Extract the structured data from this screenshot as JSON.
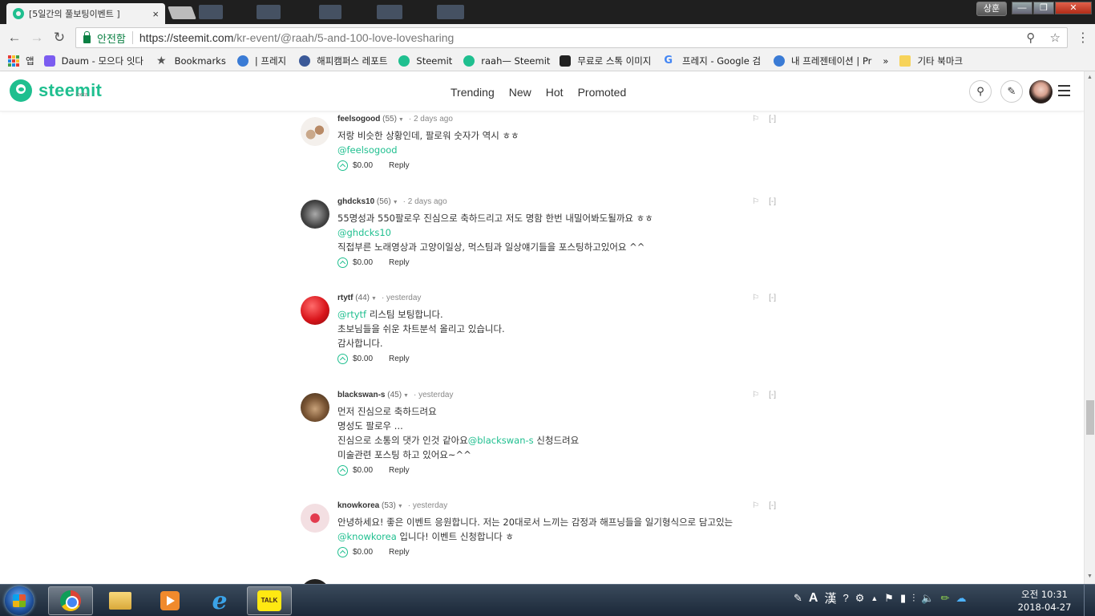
{
  "browser": {
    "tab_title": "[5일간의 풀보팅이벤트 ]",
    "tab_close": "×",
    "user_button": "상훈",
    "win_min": "—",
    "win_max": "❐",
    "win_close": "✕",
    "security_label": "안전함",
    "url_host": "https://steemit.com",
    "url_path": "/kr-event/@raah/5-and-100-love-lovesharing",
    "bookmarks": [
      {
        "label": "앱"
      },
      {
        "label": "Daum - 모으다 잇다"
      },
      {
        "label": "Bookmarks"
      },
      {
        "label": "| 프레지"
      },
      {
        "label": "해피캠퍼스 레포트"
      },
      {
        "label": "Steemit"
      },
      {
        "label": "raah— Steemit"
      },
      {
        "label": "무료로 스톡 이미지"
      },
      {
        "label": "프레지 - Google 검"
      },
      {
        "label": "내 프레젠테이션 | Pr"
      }
    ],
    "bookmarks_more": "»",
    "other_bookmarks": "기타 북마크"
  },
  "site": {
    "logo_text": "steemit",
    "logo_beta": "beta",
    "nav": [
      "Trending",
      "New",
      "Hot",
      "Promoted"
    ]
  },
  "comments": [
    {
      "author": "feelsogood",
      "rep": "(55)",
      "time": "2 days ago",
      "lines": [
        [
          {
            "t": "저랑 비슷한 상황인데, 팔로워 숫자가 역시 ㅎㅎ"
          }
        ],
        [
          {
            "t": "@feelsogood",
            "m": true
          }
        ]
      ],
      "payout": "$0.00",
      "reply": "Reply",
      "flag": "⚐",
      "collapse": "[-]",
      "avatar_color": "#e8e2dc"
    },
    {
      "author": "ghdcks10",
      "rep": "(56)",
      "time": "2 days ago",
      "lines": [
        [
          {
            "t": "55명성과 550팔로우 진심으로 축하드리고 저도 명함 한번 내밀어봐도될까요 ㅎㅎ"
          }
        ],
        [
          {
            "t": "@ghdcks10",
            "m": true
          }
        ],
        [
          {
            "t": "직접부른 노래영상과 고양이일상, 먹스팀과 일상얘기들을 포스팅하고있어요 ^^"
          }
        ]
      ],
      "payout": "$0.00",
      "reply": "Reply",
      "flag": "⚐",
      "collapse": "[-]",
      "avatar_color": "#5a5a5a"
    },
    {
      "author": "rtytf",
      "rep": "(44)",
      "time": "yesterday",
      "lines": [
        [
          {
            "t": "@rtytf",
            "m": true
          },
          {
            "t": " 리스팀 보팅합니다."
          }
        ],
        [
          {
            "t": "초보님들을 쉬운 차트분석 올리고 있습니다."
          }
        ],
        [
          {
            "t": "감사합니다."
          }
        ]
      ],
      "payout": "$0.00",
      "reply": "Reply",
      "flag": "⚐",
      "collapse": "[-]",
      "avatar_color": "#d9151b"
    },
    {
      "author": "blackswan-s",
      "rep": "(45)",
      "time": "yesterday",
      "lines": [
        [
          {
            "t": "먼저 진심으로 축하드려요"
          }
        ],
        [
          {
            "t": "명성도 팔로우 ..."
          }
        ],
        [
          {
            "t": "진심으로 소통의 댓가 인것 같아요"
          },
          {
            "t": "@blackswan-s",
            "m": true
          },
          {
            "t": " 신청드려요"
          }
        ],
        [
          {
            "t": "미술관련 포스팅 하고 있어요~^^"
          }
        ]
      ],
      "payout": "$0.00",
      "reply": "Reply",
      "flag": "⚐",
      "collapse": "[-]",
      "avatar_color": "#6b4a30"
    },
    {
      "author": "knowkorea",
      "rep": "(53)",
      "time": "yesterday",
      "lines": [
        [
          {
            "t": "안녕하세요! 좋은 이벤트 응원합니다. 저는 20대로서 느끼는 감정과 해프닝들을 일기형식으로 담고있는"
          }
        ],
        [
          {
            "t": "@knowkorea",
            "m": true
          },
          {
            "t": " 입니다! 이벤트 신청합니다 ㅎ"
          }
        ]
      ],
      "payout": "$0.00",
      "reply": "Reply",
      "flag": "⚐",
      "collapse": "[-]",
      "avatar_color": "#f3dfe2"
    }
  ],
  "taskbar": {
    "talk_label": "TALK",
    "ime_a": "A",
    "ime_han": "漢",
    "clock_time": "오전 10:31",
    "clock_date": "2018-04-27"
  }
}
